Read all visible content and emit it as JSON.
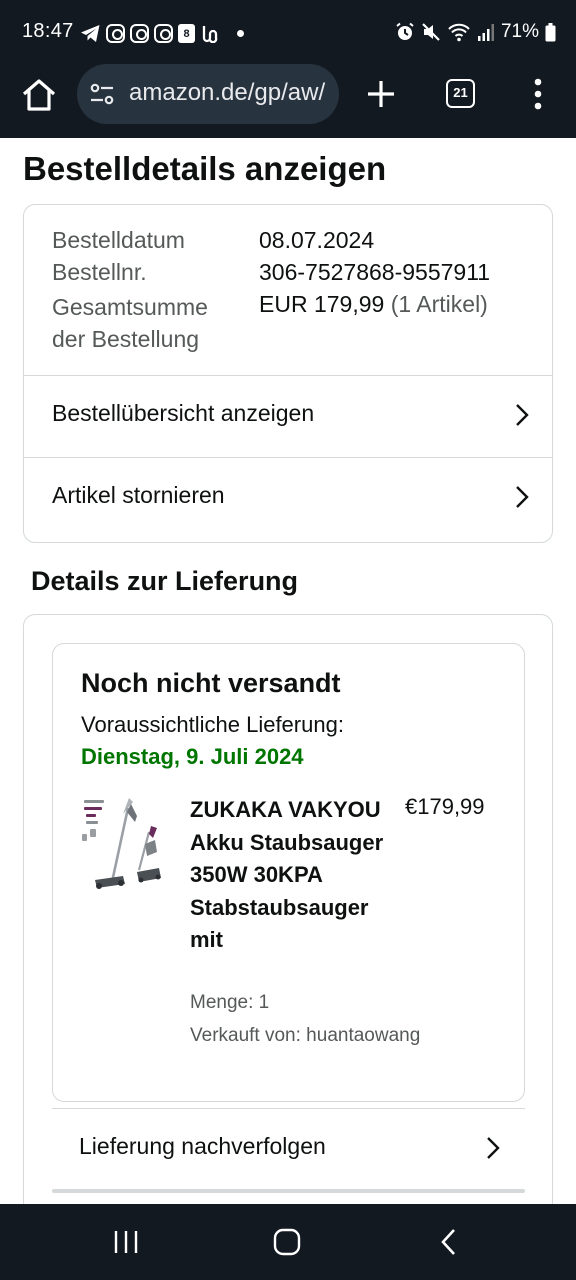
{
  "status_bar": {
    "time": "18:47",
    "battery": "71%",
    "calendar_day": "8",
    "left_icons": [
      "telegram-icon",
      "instagram-icon",
      "instagram-icon",
      "instagram-icon",
      "calendar-icon",
      "threads-icon",
      "dot-icon"
    ],
    "right_icons": [
      "alarm-icon",
      "mute-icon",
      "wifi-icon",
      "signal-icon",
      "battery-icon"
    ]
  },
  "browser": {
    "url": "amazon.de/gp/aw/",
    "tab_count": "21",
    "icons": [
      "home-icon",
      "site-settings-icon",
      "new-tab-icon",
      "tabs-icon",
      "more-icon"
    ]
  },
  "page": {
    "title": "Bestelldetails anzeigen",
    "summary": {
      "date_label": "Bestelldatum",
      "date_value": "08.07.2024",
      "number_label": "Bestellnr.",
      "number_value": "306-7527868-9557911",
      "total_label_line1": "Gesamtsumme",
      "total_label_line2": "der Bestellung",
      "total_value": "EUR 179,99",
      "total_items": "(1 Artikel)"
    },
    "links": {
      "overview": "Bestellübersicht anzeigen",
      "cancel": "Artikel stornieren"
    },
    "delivery": {
      "section_title": "Details zur Lieferung",
      "status": "Noch nicht versandt",
      "estimate_label": "Voraussichtliche Lieferung:",
      "estimate_date": "Dienstag, 9. Juli 2024",
      "product": {
        "title": "ZUKAKA VAKYOU Akku Staubsauger 350W 30KPA Stabstaubsauger mit",
        "price": "€179,99",
        "quantity": "Menge: 1",
        "seller": "Verkauft von: huantaowang"
      },
      "track_label": "Lieferung nachverfolgen"
    }
  },
  "colors": {
    "header_bg": "#131921",
    "omnibox_bg": "#283340",
    "delivery_green": "#007600",
    "border": "#d5d9d9",
    "muted_text": "#565959"
  }
}
